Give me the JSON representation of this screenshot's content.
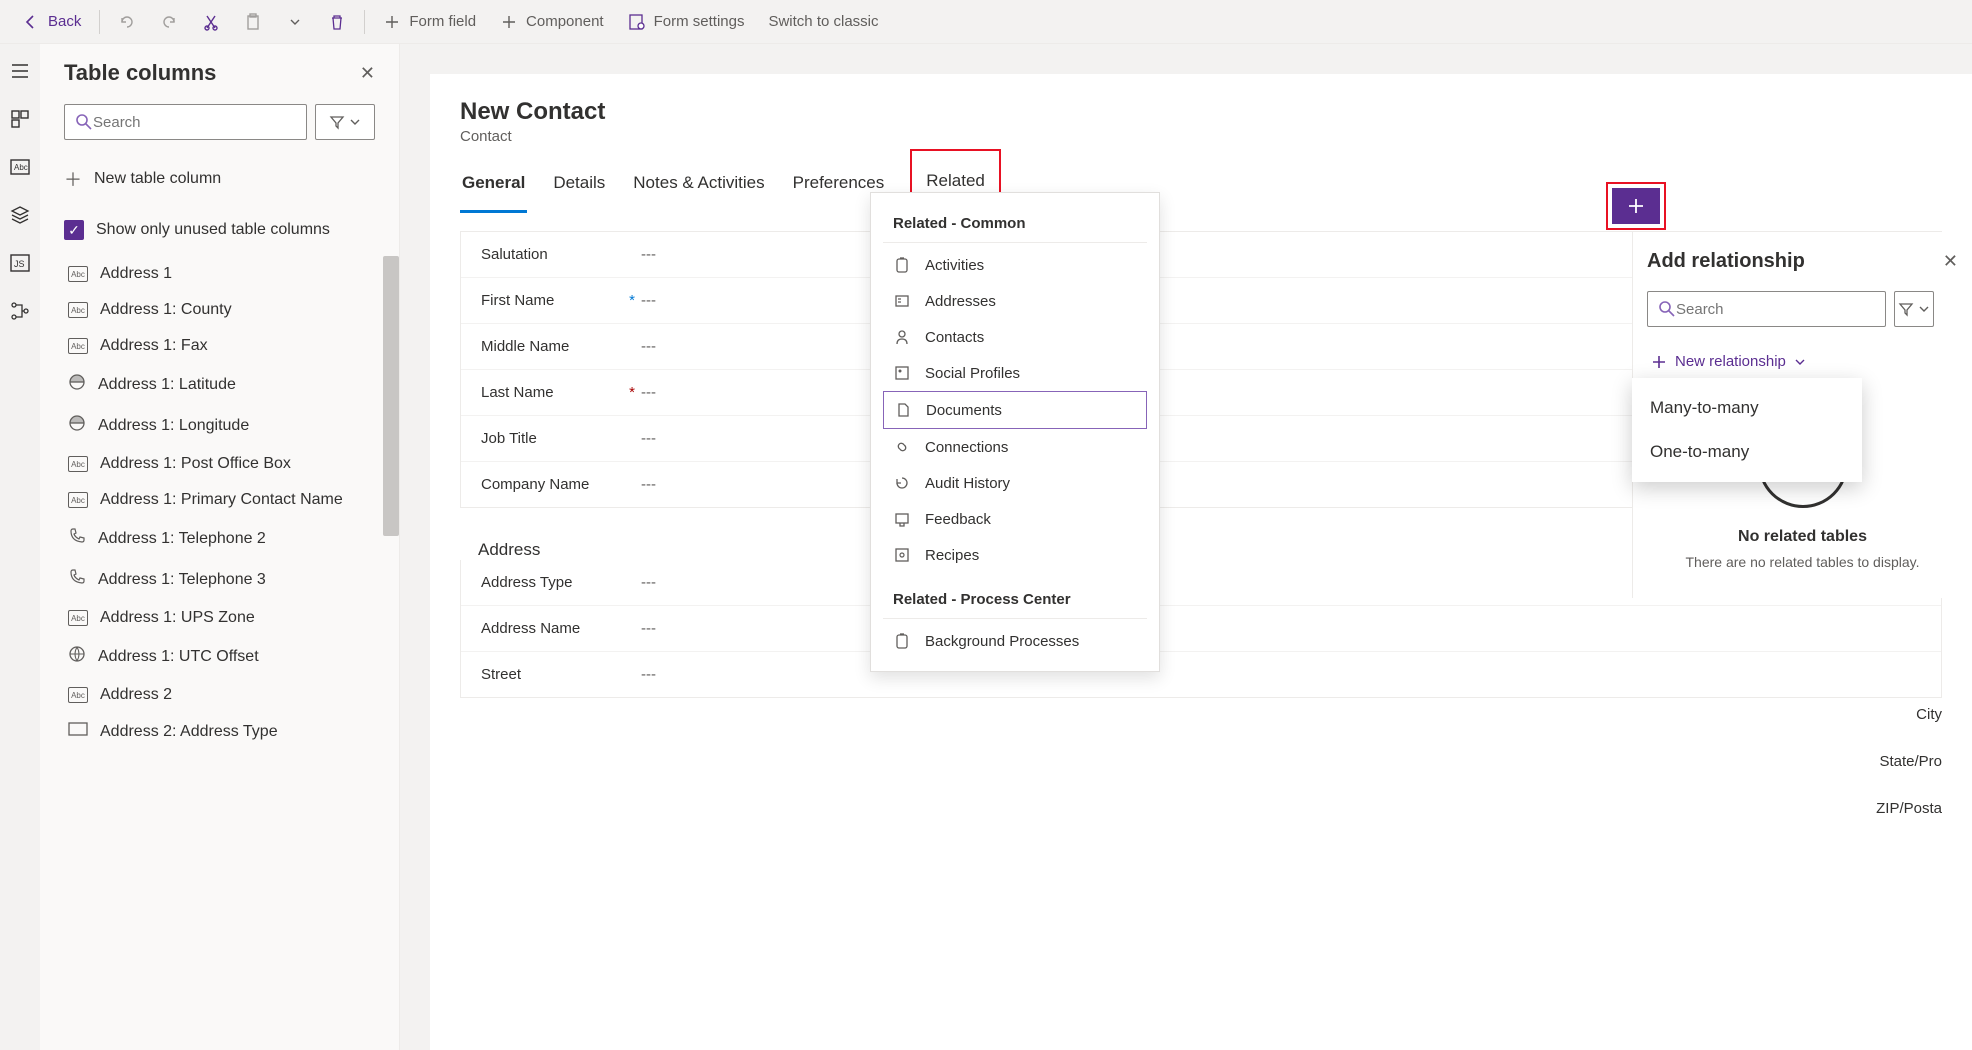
{
  "toolbar": {
    "back": "Back",
    "form_field": "Form field",
    "component": "Component",
    "form_settings": "Form settings",
    "switch_classic": "Switch to classic"
  },
  "side_panel": {
    "title": "Table columns",
    "search_placeholder": "Search",
    "new_column": "New table column",
    "show_unused": "Show only unused table columns",
    "columns": [
      {
        "type": "abcdef",
        "label": "Address 1"
      },
      {
        "type": "abc",
        "label": "Address 1: County"
      },
      {
        "type": "abc",
        "label": "Address 1: Fax"
      },
      {
        "type": "globe",
        "label": "Address 1: Latitude"
      },
      {
        "type": "globe",
        "label": "Address 1: Longitude"
      },
      {
        "type": "abc",
        "label": "Address 1: Post Office Box"
      },
      {
        "type": "abc",
        "label": "Address 1: Primary Contact Name"
      },
      {
        "type": "phone",
        "label": "Address 1: Telephone 2"
      },
      {
        "type": "phone",
        "label": "Address 1: Telephone 3"
      },
      {
        "type": "abc",
        "label": "Address 1: UPS Zone"
      },
      {
        "type": "utc",
        "label": "Address 1: UTC Offset"
      },
      {
        "type": "abcdef",
        "label": "Address 2"
      },
      {
        "type": "rect",
        "label": "Address 2: Address Type"
      }
    ]
  },
  "form": {
    "title": "New Contact",
    "subtitle": "Contact",
    "tabs": [
      "General",
      "Details",
      "Notes & Activities",
      "Preferences",
      "Related"
    ],
    "active_tab": 0,
    "fields": [
      {
        "label": "Salutation",
        "val": "---",
        "req": ""
      },
      {
        "label": "First Name",
        "val": "---",
        "req": "blue"
      },
      {
        "label": "Middle Name",
        "val": "---",
        "req": ""
      },
      {
        "label": "Last Name",
        "val": "---",
        "req": "red"
      },
      {
        "label": "Job Title",
        "val": "---",
        "req": ""
      },
      {
        "label": "Company Name",
        "val": "---",
        "req": ""
      }
    ],
    "address_title": "Address",
    "address_fields": [
      {
        "label": "Address Type",
        "val": "---"
      },
      {
        "label": "Address Name",
        "val": "---"
      },
      {
        "label": "Street",
        "val": "---"
      }
    ],
    "address_right": [
      "City",
      "State/Pro",
      "ZIP/Posta"
    ]
  },
  "related_menu": {
    "group1_title": "Related - Common",
    "group1": [
      "Activities",
      "Addresses",
      "Contacts",
      "Social Profiles",
      "Documents",
      "Connections",
      "Audit History",
      "Feedback",
      "Recipes"
    ],
    "selected_index": 4,
    "group2_title": "Related - Process Center",
    "group2": [
      "Background Processes"
    ]
  },
  "right_panel": {
    "title": "Add relationship",
    "search_placeholder": "Search",
    "new_rel": "New relationship",
    "options": [
      "Many-to-many",
      "One-to-many"
    ],
    "empty_title": "No related tables",
    "empty_sub": "There are no related tables to display."
  }
}
